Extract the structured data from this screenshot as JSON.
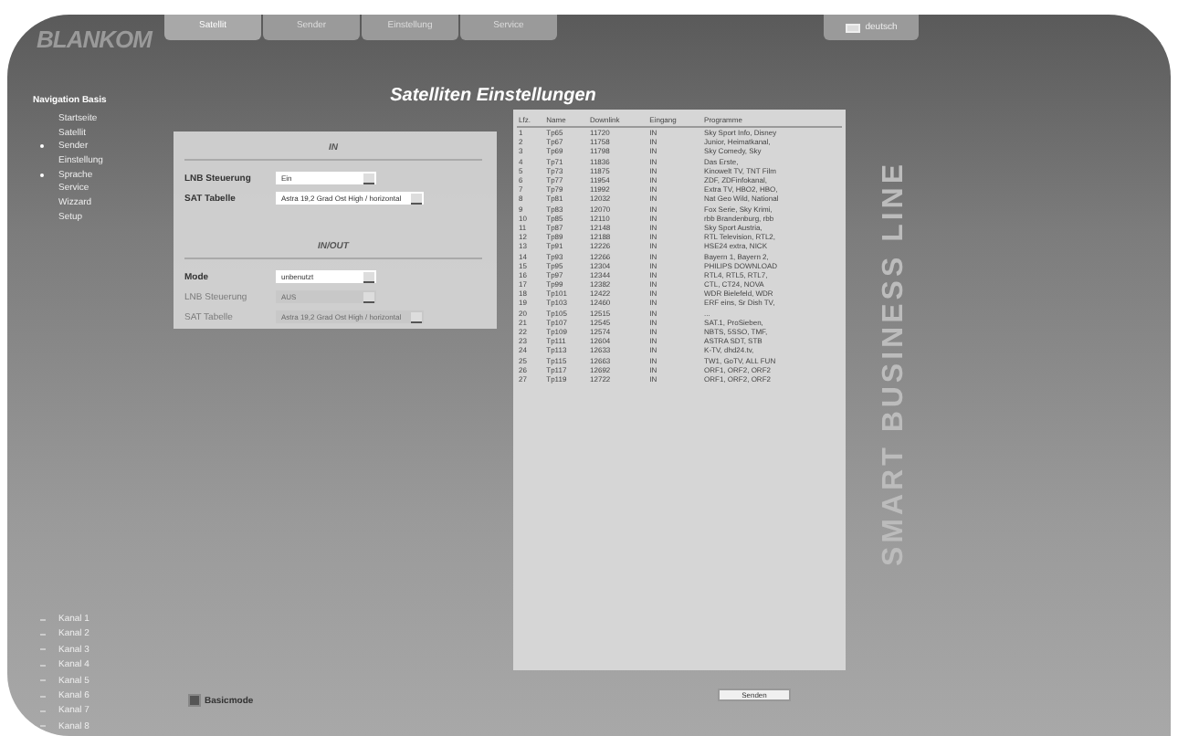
{
  "logo": "BLANKOM",
  "tabs": [
    {
      "label": "Satellit",
      "selected": true
    },
    {
      "label": "Sender",
      "selected": false
    },
    {
      "label": "Einstellung",
      "selected": false
    },
    {
      "label": "Service",
      "selected": false
    }
  ],
  "language": "deutsch",
  "navigation": {
    "title": "Navigation Basis",
    "items": [
      {
        "label": "Startseite",
        "bullet": false
      },
      {
        "label": "Satellit",
        "bullet": false
      },
      {
        "label": "Sender",
        "bullet": true
      },
      {
        "label": "Einstellung",
        "bullet": false
      },
      {
        "label": "Sprache",
        "bullet": true
      },
      {
        "label": "Service",
        "bullet": false
      },
      {
        "label": "Wizzard",
        "bullet": false
      },
      {
        "label": "Setup",
        "bullet": false
      }
    ]
  },
  "channels": [
    "Kanal 1",
    "Kanal 2",
    "Kanal 3",
    "Kanal 4",
    "Kanal 5",
    "Kanal 6",
    "Kanal 7",
    "Kanal 8"
  ],
  "title": "Satelliten Einstellungen",
  "sections": [
    {
      "title": "IN",
      "rows": [
        {
          "label": "LNB Steuerung",
          "value": "Ein",
          "disabled": false
        },
        {
          "label": "SAT Tabelle",
          "value": "Astra 19,2 Grad Ost High / horizontal",
          "disabled": false
        }
      ]
    },
    {
      "title": "IN/OUT",
      "rows": [
        {
          "label": "Mode",
          "value": "unbenutzt",
          "disabled": false
        },
        {
          "label": "LNB Steuerung",
          "value": "AUS",
          "disabled": true
        },
        {
          "label": "SAT Tabelle",
          "value": "Astra 19,2 Grad Ost High / horizontal",
          "disabled": true
        }
      ]
    }
  ],
  "basicmode": {
    "label": "Basicmode",
    "checked": true
  },
  "table": {
    "columns": [
      "Lfz.",
      "Name",
      "Downlink",
      "Eingang",
      "Programme"
    ],
    "rows": [
      [
        "1",
        "Tp65",
        "11720",
        "IN",
        "Sky Sport Info, Disney"
      ],
      [
        "2",
        "Tp67",
        "11758",
        "IN",
        "Junior, Heimatkanal,"
      ],
      [
        "3",
        "Tp69",
        "11798",
        "IN",
        "Sky Comedy, Sky"
      ],
      [
        "4",
        "Tp71",
        "11836",
        "IN",
        "Das Erste,"
      ],
      [
        "5",
        "Tp73",
        "11875",
        "IN",
        "Kinowelt TV, TNT Film"
      ],
      [
        "6",
        "Tp77",
        "11954",
        "IN",
        "ZDF, ZDFinfokanal,"
      ],
      [
        "7",
        "Tp79",
        "11992",
        "IN",
        "Extra TV, HBO2, HBO,"
      ],
      [
        "8",
        "Tp81",
        "12032",
        "IN",
        "Nat Geo Wild, National"
      ],
      [
        "9",
        "Tp83",
        "12070",
        "IN",
        "Fox Serie, Sky Krimi,"
      ],
      [
        "10",
        "Tp85",
        "12110",
        "IN",
        "rbb Brandenburg, rbb"
      ],
      [
        "11",
        "Tp87",
        "12148",
        "IN",
        "Sky Sport Austria,"
      ],
      [
        "12",
        "Tp89",
        "12188",
        "IN",
        "RTL Television, RTL2,"
      ],
      [
        "13",
        "Tp91",
        "12226",
        "IN",
        "HSE24 extra, NICK"
      ],
      [
        "14",
        "Tp93",
        "12266",
        "IN",
        "Bayern 1, Bayern 2,"
      ],
      [
        "15",
        "Tp95",
        "12304",
        "IN",
        "PHILIPS DOWNLOAD"
      ],
      [
        "16",
        "Tp97",
        "12344",
        "IN",
        "RTL4, RTL5, RTL7,"
      ],
      [
        "17",
        "Tp99",
        "12382",
        "IN",
        "CTL, CT24, NOVA"
      ],
      [
        "18",
        "Tp101",
        "12422",
        "IN",
        "WDR Bielefeld, WDR"
      ],
      [
        "19",
        "Tp103",
        "12460",
        "IN",
        "ERF eins, Sr Dish TV,"
      ],
      [
        "20",
        "Tp105",
        "12515",
        "IN",
        "..."
      ],
      [
        "21",
        "Tp107",
        "12545",
        "IN",
        "SAT.1, ProSieben,"
      ],
      [
        "22",
        "Tp109",
        "12574",
        "IN",
        "NBTS, 5SSO, TMF,"
      ],
      [
        "23",
        "Tp111",
        "12604",
        "IN",
        "ASTRA SDT, STB"
      ],
      [
        "24",
        "Tp113",
        "12633",
        "IN",
        "K-TV, dhd24.tv,"
      ],
      [
        "25",
        "Tp115",
        "12663",
        "IN",
        "TW1, GoTV, ALL FUN"
      ],
      [
        "26",
        "Tp117",
        "12692",
        "IN",
        "ORF1, ORF2, ORF2"
      ],
      [
        "27",
        "Tp119",
        "12722",
        "IN",
        "ORF1, ORF2, ORF2"
      ]
    ]
  },
  "send_button": "Senden",
  "brand_line": "SMART BUSINESS LINE"
}
